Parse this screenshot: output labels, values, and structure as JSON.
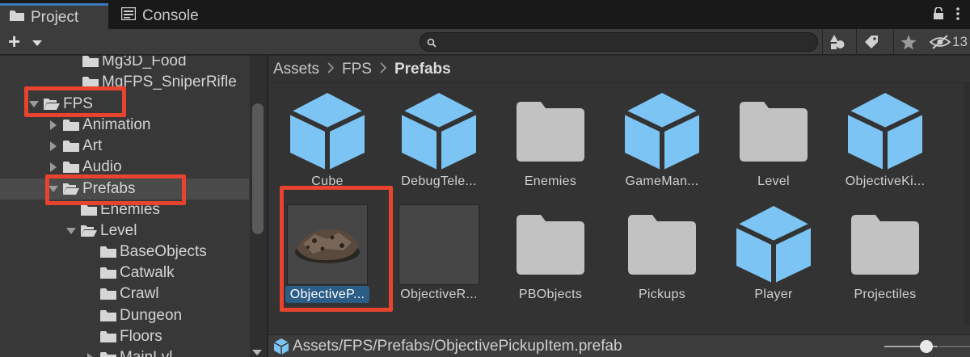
{
  "tabs": [
    {
      "label": "Project",
      "icon": "folder-icon",
      "active": true
    },
    {
      "label": "Console",
      "icon": "console-icon",
      "active": false
    }
  ],
  "toolbar": {
    "search_placeholder": "",
    "hidden_count": "13"
  },
  "tree": [
    {
      "label": "Mg3D_Food",
      "expanded": null
    },
    {
      "label": "MgFPS_SniperRifle",
      "expanded": null
    },
    {
      "label": "FPS",
      "expanded": true
    },
    {
      "label": "Animation",
      "expanded": false
    },
    {
      "label": "Art",
      "expanded": false
    },
    {
      "label": "Audio",
      "expanded": false
    },
    {
      "label": "Prefabs",
      "expanded": true,
      "selected": true
    },
    {
      "label": "Enemies",
      "expanded": null
    },
    {
      "label": "Level",
      "expanded": true
    },
    {
      "label": "BaseObjects",
      "expanded": null
    },
    {
      "label": "Catwalk",
      "expanded": null
    },
    {
      "label": "Crawl",
      "expanded": null
    },
    {
      "label": "Dungeon",
      "expanded": null
    },
    {
      "label": "Floors",
      "expanded": null
    },
    {
      "label": "MainLvl",
      "expanded": false
    }
  ],
  "breadcrumb": [
    "Assets",
    "FPS",
    "Prefabs"
  ],
  "assets": [
    {
      "label": "Cube",
      "kind": "prefab"
    },
    {
      "label": "DebugTele...",
      "kind": "prefab"
    },
    {
      "label": "Enemies",
      "kind": "folder"
    },
    {
      "label": "GameMan...",
      "kind": "prefab"
    },
    {
      "label": "Level",
      "kind": "folder"
    },
    {
      "label": "ObjectiveKi...",
      "kind": "prefab"
    },
    {
      "label": "ObjectiveP...",
      "kind": "model",
      "selected": true
    },
    {
      "label": "ObjectiveR...",
      "kind": "blank"
    },
    {
      "label": "PBObjects",
      "kind": "folder"
    },
    {
      "label": "Pickups",
      "kind": "folder"
    },
    {
      "label": "Player",
      "kind": "prefab"
    },
    {
      "label": "Projectiles",
      "kind": "folder"
    }
  ],
  "status": {
    "path": "Assets/FPS/Prefabs/ObjectivePickupItem.prefab"
  },
  "colors": {
    "prefab_blue": "#7cc4f4",
    "folder_gray": "#c2c2c2",
    "selection_blue": "#2c5d87",
    "highlight_red": "#e8432e",
    "tab_accent": "#3a79bb"
  }
}
